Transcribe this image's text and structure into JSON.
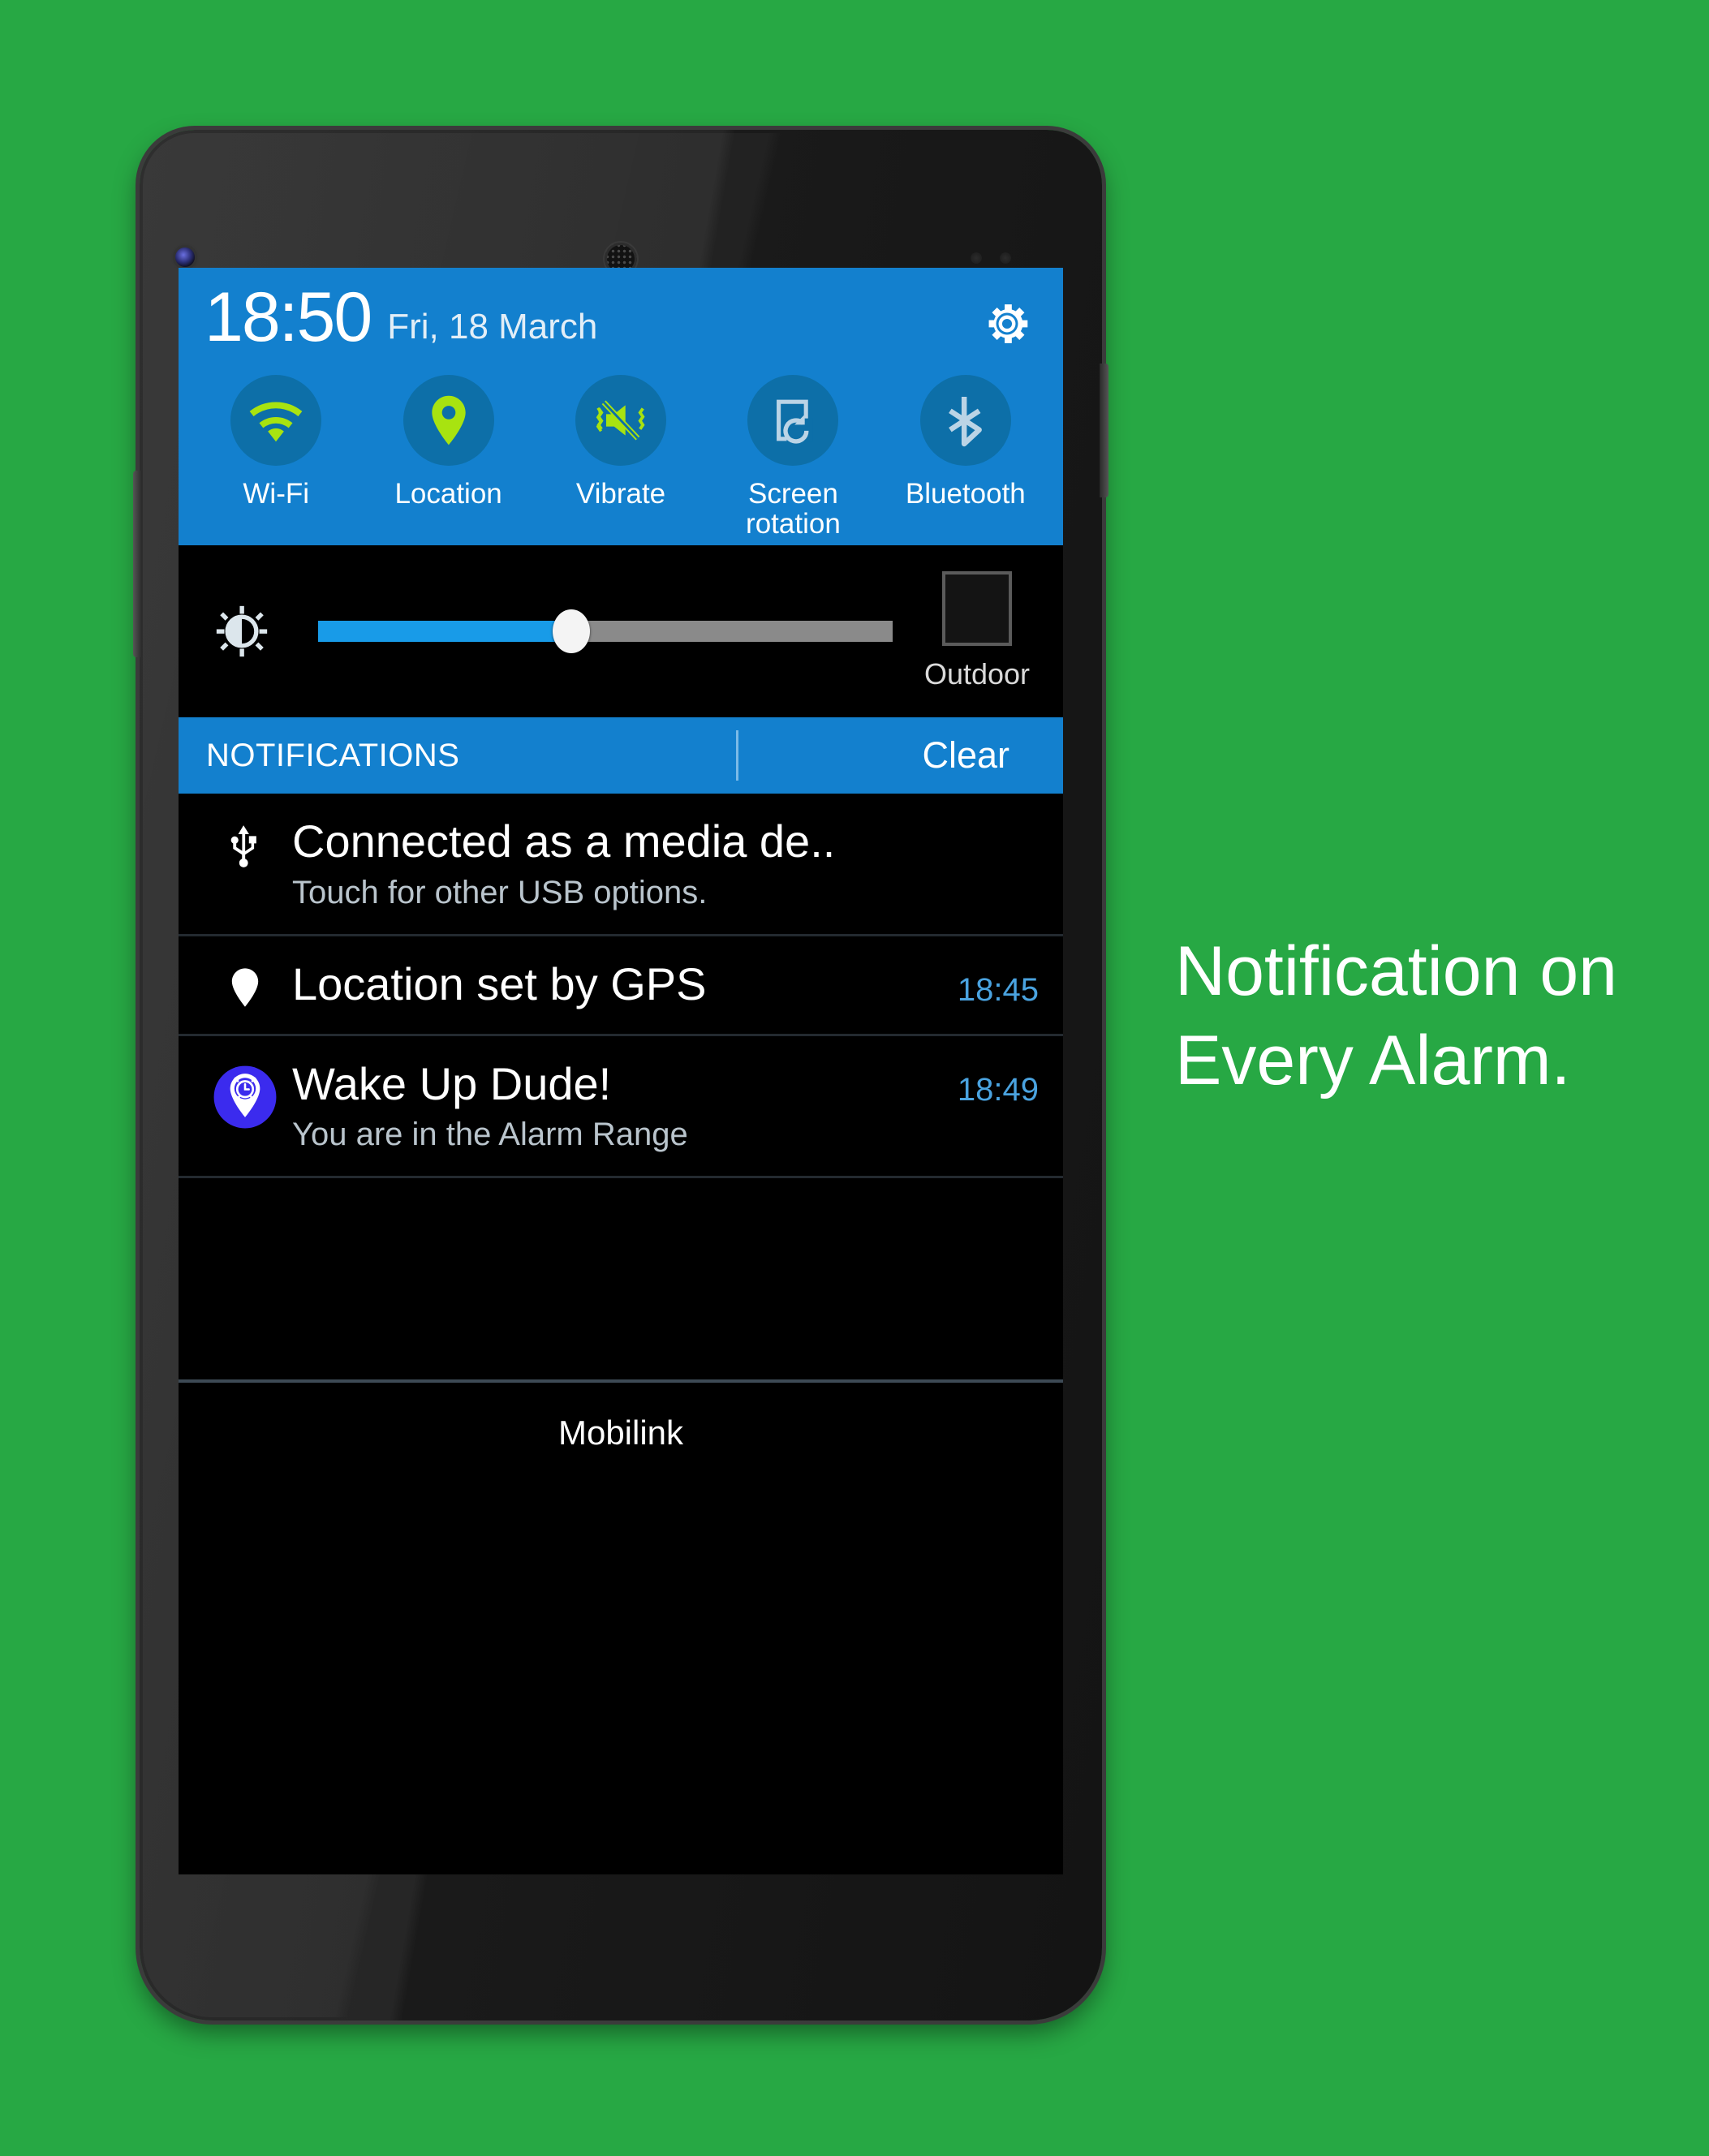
{
  "background_color": "#27A844",
  "promo": {
    "line1": "Notification on",
    "line2": "Every Alarm."
  },
  "statusbar": {
    "time": "18:50",
    "date": "Fri, 18 March",
    "settings_icon": "gear-icon"
  },
  "quick_settings": {
    "panel_color": "#1380CE",
    "circle_color": "#0D6FA8",
    "active_icon_color": "#A8E310",
    "inactive_icon_color": "#BBD4E6",
    "toggles": [
      {
        "label": "Wi-Fi",
        "icon": "wifi-icon",
        "active": true
      },
      {
        "label": "Location",
        "icon": "location-pin-icon",
        "active": true
      },
      {
        "label": "Vibrate",
        "icon": "vibrate-mute-icon",
        "active": true
      },
      {
        "label": "Screen\nrotation",
        "icon": "screen-rotation-icon",
        "active": false
      },
      {
        "label": "Bluetooth",
        "icon": "bluetooth-icon",
        "active": false
      }
    ],
    "toggle_labels": {
      "wifi": "Wi-Fi",
      "location": "Location",
      "vibrate": "Vibrate",
      "screen_rotation_line1": "Screen",
      "screen_rotation_line2": "rotation",
      "bluetooth": "Bluetooth"
    }
  },
  "brightness": {
    "icon": "brightness-icon",
    "value_percent": 44,
    "fill_color": "#189BE8",
    "track_color": "#8A8A8A",
    "outdoor_label": "Outdoor",
    "outdoor_checked": false
  },
  "notifications_header": {
    "title": "NOTIFICATIONS",
    "clear_label": "Clear"
  },
  "notifications": [
    {
      "icon": "usb-icon",
      "title": "Connected as a media de..",
      "subtitle": "Touch for other USB options.",
      "time": ""
    },
    {
      "icon": "location-pin-icon",
      "title": "Location set by GPS",
      "subtitle": "",
      "time": "18:45"
    },
    {
      "icon": "alarm-pin-icon",
      "title": "Wake Up Dude!",
      "subtitle": "You are in the Alarm Range",
      "time": "18:49"
    }
  ],
  "carrier": {
    "name": "Mobilink"
  }
}
